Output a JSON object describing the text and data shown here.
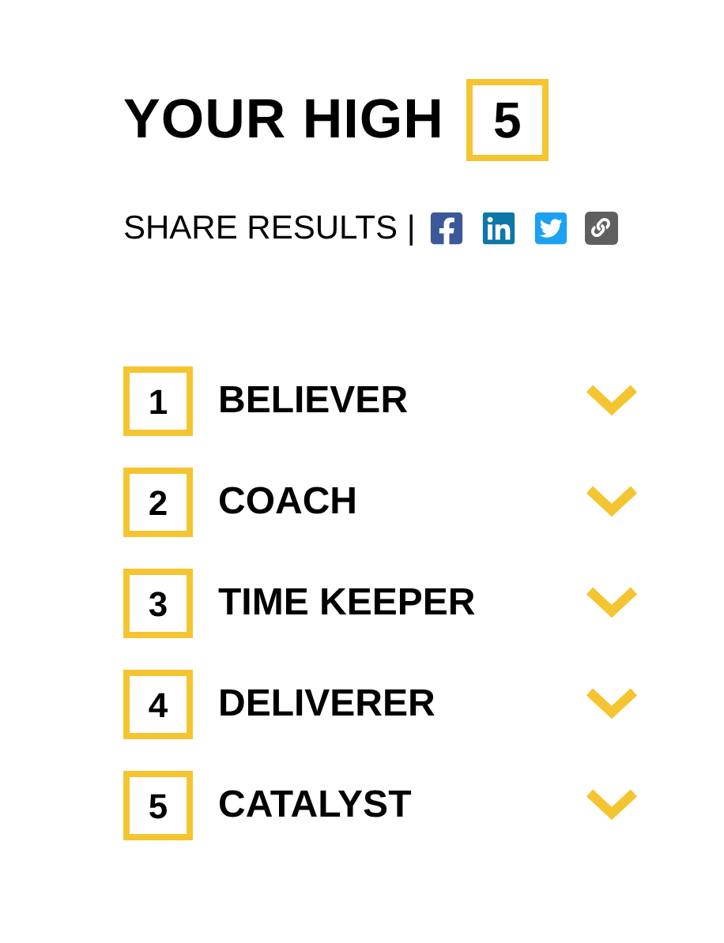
{
  "title": {
    "text": "YOUR HIGH",
    "count": "5"
  },
  "share": {
    "label": "SHARE RESULTS |",
    "links": [
      {
        "kind": "facebook"
      },
      {
        "kind": "linkedin"
      },
      {
        "kind": "twitter"
      },
      {
        "kind": "link"
      }
    ]
  },
  "strengths": [
    {
      "rank": "1",
      "name": "BELIEVER",
      "expanded": false
    },
    {
      "rank": "2",
      "name": "COACH",
      "expanded": false
    },
    {
      "rank": "3",
      "name": "TIME KEEPER",
      "expanded": false
    },
    {
      "rank": "4",
      "name": "DELIVERER",
      "expanded": false
    },
    {
      "rank": "5",
      "name": "CATALYST",
      "expanded": false
    }
  ]
}
